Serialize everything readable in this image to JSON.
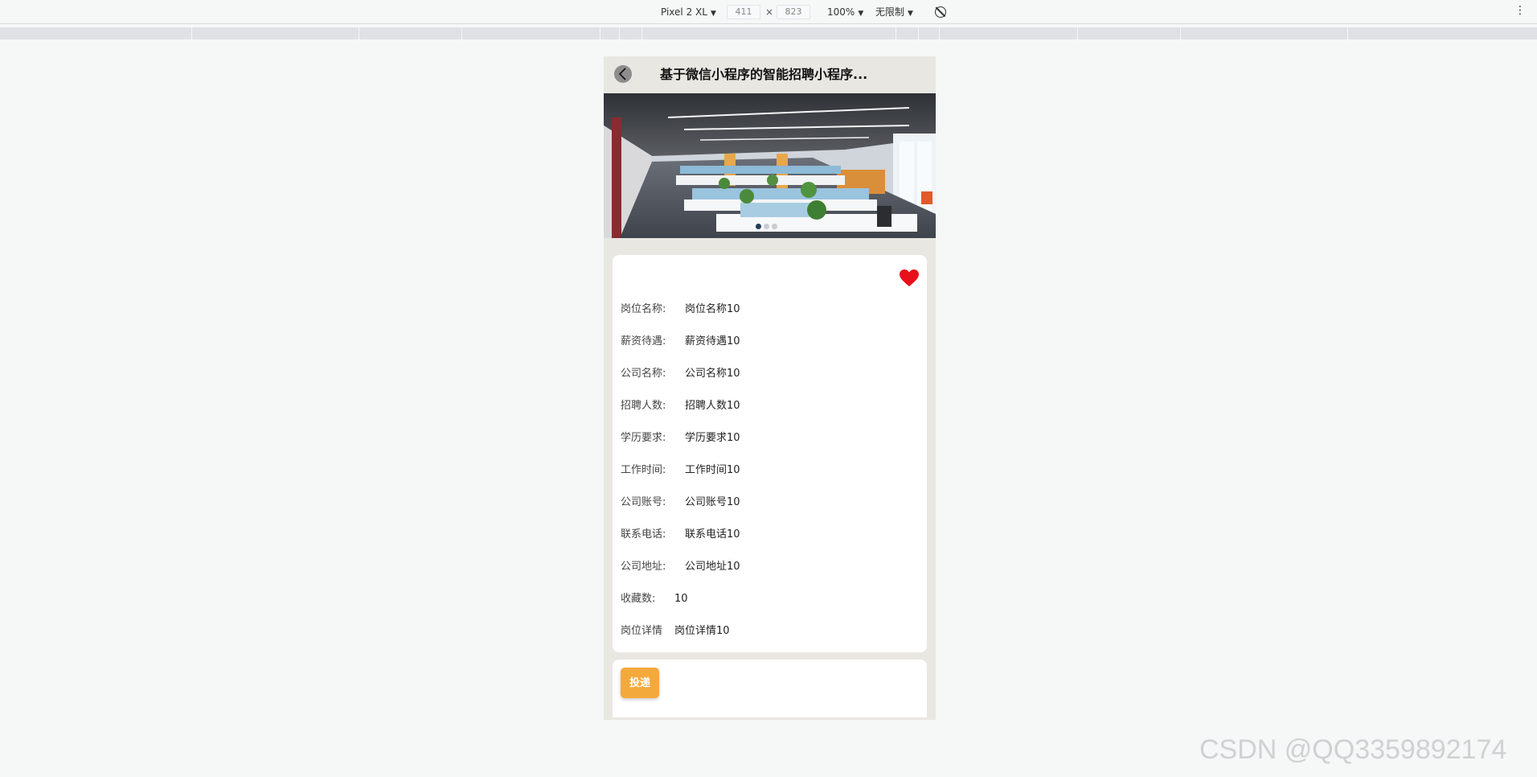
{
  "devtools": {
    "device": "Pixel 2 XL",
    "width": "411",
    "times": "×",
    "height": "823",
    "zoom": "100%",
    "throttle": "无限制",
    "more": "⋮"
  },
  "app": {
    "title": "基于微信小程序的智能招聘小程序...",
    "banner_dots": 3,
    "active_dot": 0,
    "favorite_active": true,
    "details": [
      {
        "label": "岗位名称:",
        "value": "岗位名称10"
      },
      {
        "label": "薪资待遇:",
        "value": "薪资待遇10"
      },
      {
        "label": "公司名称:",
        "value": "公司名称10"
      },
      {
        "label": "招聘人数:",
        "value": "招聘人数10"
      },
      {
        "label": "学历要求:",
        "value": "学历要求10"
      },
      {
        "label": "工作时间:",
        "value": "工作时间10"
      },
      {
        "label": "公司账号:",
        "value": "公司账号10"
      },
      {
        "label": "联系电话:",
        "value": "联系电话10"
      },
      {
        "label": "公司地址:",
        "value": "公司地址10"
      },
      {
        "label": "收藏数:",
        "value": "10"
      },
      {
        "label": "岗位详情",
        "value": "岗位详情10"
      }
    ],
    "apply_label": "投递"
  },
  "watermark": "CSDN @QQ3359892174",
  "colors": {
    "accent": "#f4a93c",
    "heart": "#e8101a",
    "frame": "#e9e7e2"
  }
}
